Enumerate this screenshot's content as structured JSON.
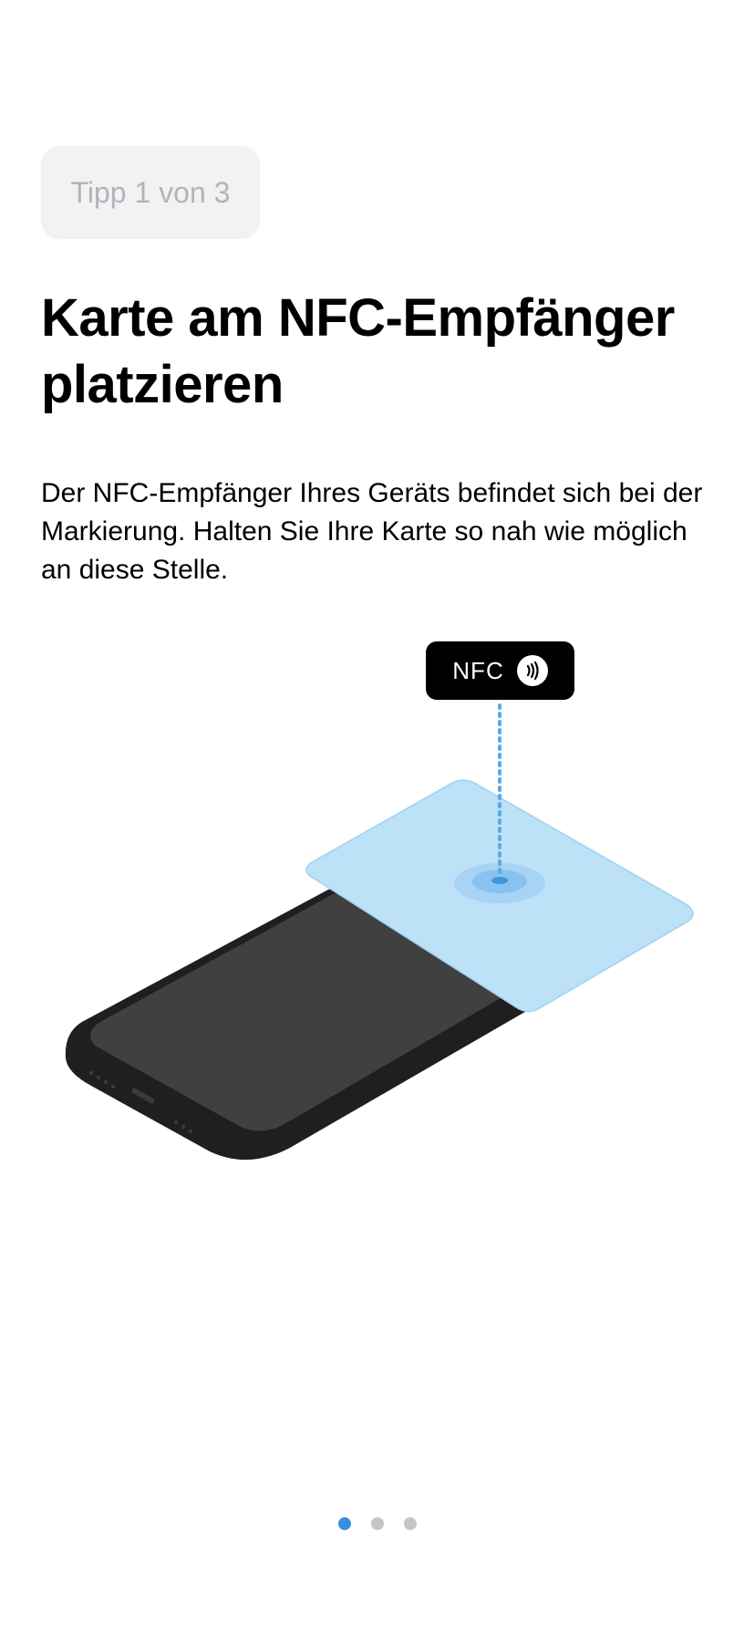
{
  "tip_badge": {
    "label": "Tipp 1 von 3"
  },
  "title": "Karte am NFC-Empfänger platzieren",
  "description": "Der NFC-Empfänger Ihres Geräts befindet sich bei der Markierung. Halten Sie Ihre Karte so nah wie möglich an diese Stelle.",
  "illustration": {
    "nfc_label": "NFC",
    "nfc_icon": "contactless-icon",
    "colors": {
      "card": "#bde1f7",
      "marker": "#5aaae6",
      "phone_body": "#1f1f1f",
      "phone_screen": "#404040"
    }
  },
  "pager": {
    "page_count": 3,
    "current_page": 1,
    "colors": {
      "active": "#3a8fdc",
      "inactive": "#c5c5c7"
    }
  }
}
